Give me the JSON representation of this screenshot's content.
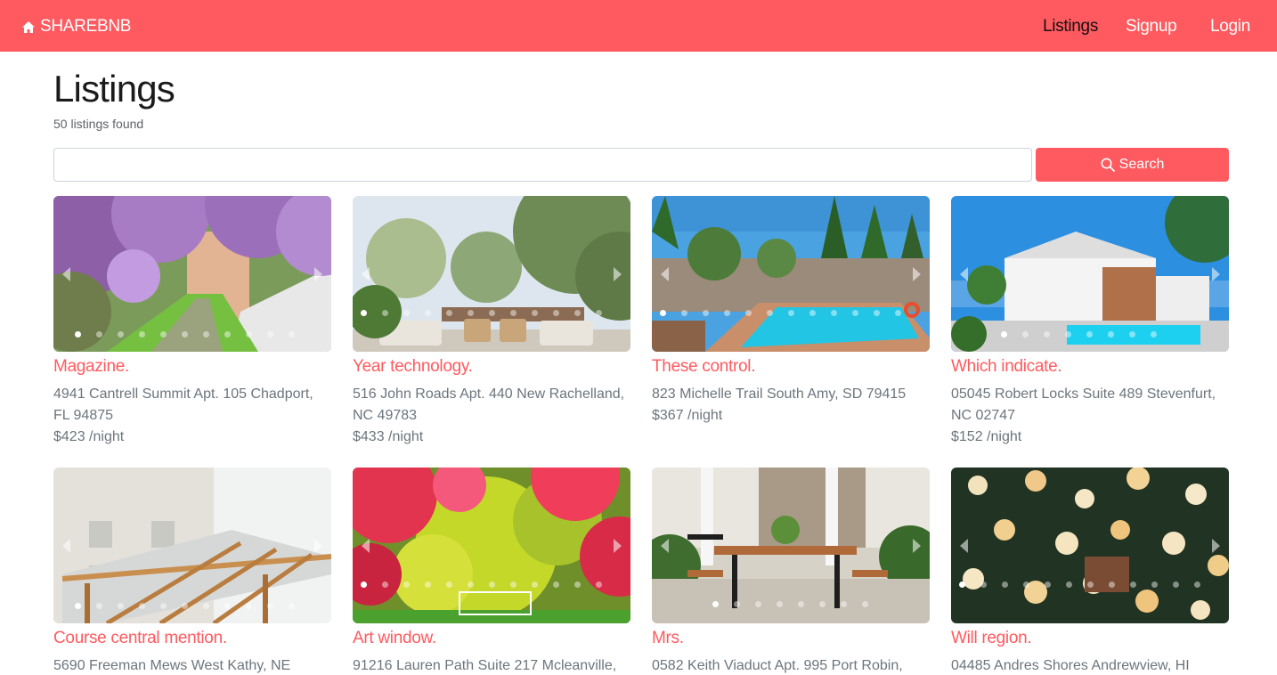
{
  "brand": {
    "name": "SHAREBNB",
    "icon": "home-icon"
  },
  "nav": {
    "listings": "Listings",
    "signup": "Signup",
    "login": "Login"
  },
  "page": {
    "title": "Listings",
    "count_text": "50 listings found"
  },
  "search": {
    "value": "",
    "placeholder": "",
    "button_label": "Search",
    "icon": "search-icon"
  },
  "colors": {
    "brand": "#ff5a5f",
    "text_muted": "#6c757d"
  },
  "listings": [
    {
      "title": "Magazine.",
      "address": "4941 Cantrell Summit Apt. 105 Chadport, FL 94875",
      "price": "$423 /night",
      "image": "lilac-garden-path"
    },
    {
      "title": "Year technology.",
      "address": "516 John Roads Apt. 440 New Rachelland, NC 49783",
      "price": "$433 /night",
      "image": "patio-with-sofas"
    },
    {
      "title": "These control.",
      "address": "823 Michelle Trail South Amy, SD 79415",
      "price": "$367 /night",
      "image": "backyard-pool"
    },
    {
      "title": "Which indicate.",
      "address": "05045 Robert Locks Suite 489 Stevenfurt, NC 02747",
      "price": "$152 /night",
      "image": "white-villa-pool"
    },
    {
      "title": "Course central mention.",
      "address": "5690 Freeman Mews West Kathy, NE",
      "price": "",
      "image": "wooden-pergola"
    },
    {
      "title": "Art window.",
      "address": "91216 Lauren Path Suite 217 Mcleanville,",
      "price": "",
      "image": "autumn-garden"
    },
    {
      "title": "Mrs.",
      "address": "0582 Keith Viaduct Apt. 995 Port Robin,",
      "price": "",
      "image": "porch-dining-set"
    },
    {
      "title": "Will region.",
      "address": "04485 Andres Shores Andrewview, HI",
      "price": "",
      "image": "rose-wall"
    }
  ]
}
